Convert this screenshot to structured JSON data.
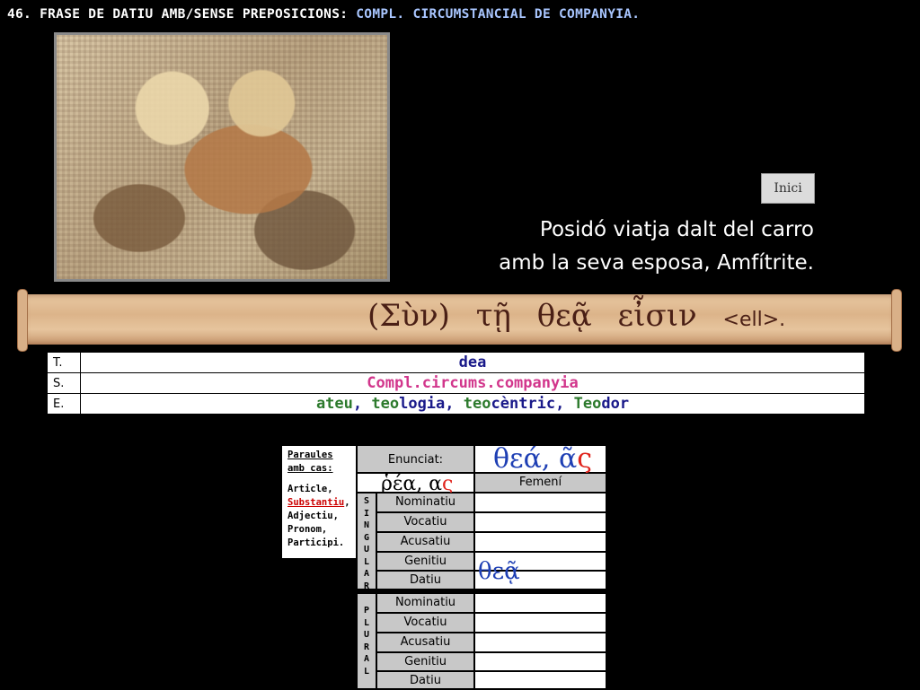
{
  "title": {
    "prefix": "46. FRASE DE DATIU AMB/SENSE PREPOSICIONS:",
    "highlight": "COMPL. CIRCUMSTANCIAL DE COMPANYIA."
  },
  "image": {
    "subject": "Posidó i Amfítrite"
  },
  "inici_label": "Inici",
  "caption": {
    "line1": "Posidó viatja  dalt del carro",
    "line2": "amb la seva esposa, Amfítrite."
  },
  "scroll": {
    "greek": "(Σὺν)  τῇ  θεᾷ  εἶσιν",
    "ell": "<ell>."
  },
  "tse": {
    "t_key": "T.",
    "t_value": "dea",
    "s_key": "S.",
    "s_value": "Compl.circums.companyia",
    "e_key": "E.",
    "e_parts": {
      "p1": "ateu",
      "p2": ", ",
      "p3": "teo",
      "p4": "logia",
      "p5": ", ",
      "p6": "teo",
      "p7": "cèntric",
      "p8": ", ",
      "p9": "Teo",
      "p10": "dor"
    }
  },
  "decl": {
    "left": {
      "l1": "Paraules",
      "l2": "amb cas:",
      "l3": "Article,",
      "l4": "Substantiu",
      "l4b": ",",
      "l5": "Adjectiu,",
      "l6": "Pronom,",
      "l7": "Participi."
    },
    "enunciat_label": "Enunciat:",
    "enunciat_greek": "θεά, ",
    "enunciat_ending_a": "ᾶ",
    "enunciat_ending_s": "ς",
    "rea_greek": "ῥέα, α",
    "rea_ending": "ς",
    "gender": "Femení",
    "singular_vertical": [
      "S",
      "I",
      "N",
      "G",
      "U",
      "L",
      "A",
      "R"
    ],
    "plural_vertical": [
      "P",
      "L",
      "U",
      "R",
      "A",
      "L"
    ],
    "cases": [
      "Nominatiu",
      "Vocatiu",
      "Acusatiu",
      "Genitiu",
      "Datiu"
    ],
    "datiu_form": "θεᾷ"
  }
}
